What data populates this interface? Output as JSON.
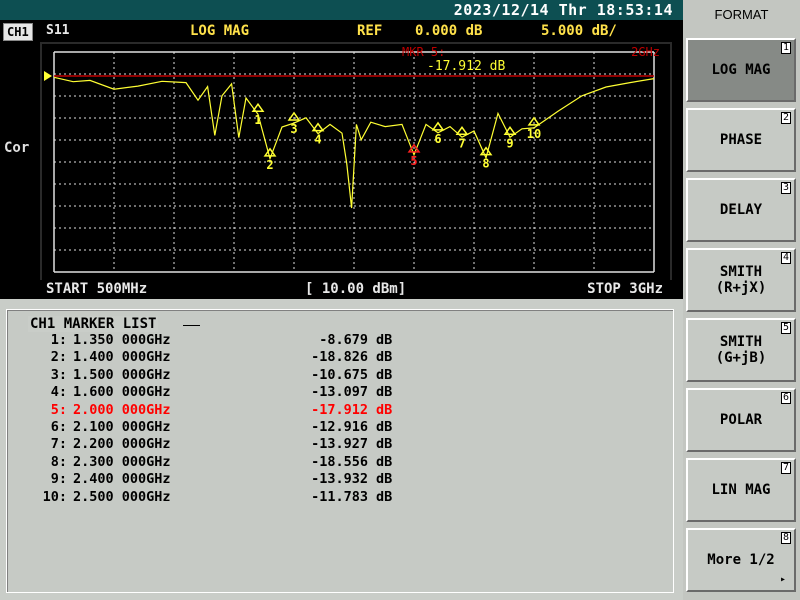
{
  "status": {
    "datetime": "2023/12/14 Thr 18:53:14"
  },
  "header": {
    "channel": "CH1",
    "sparam": "S11",
    "format": "LOG MAG",
    "ref_label": "REF",
    "ref_value": "0.000 dB",
    "scale": "5.000 dB/"
  },
  "side_label": "Cor",
  "plot": {
    "marker_readout_label": "MKR  5:",
    "marker_readout_freq": "2GHz",
    "marker_readout_value": "-17.912 dB",
    "start": "START 500MHz",
    "power": "[ 10.00 dBm]",
    "stop": "STOP 3GHz",
    "colors": {
      "trace": "#ffff33",
      "ref_line": "#c00000",
      "grid": "#e0e0e0",
      "active_marker": "#ff2020"
    }
  },
  "chart_data": {
    "type": "line",
    "x": [
      0.5,
      0.58,
      0.65,
      0.75,
      0.85,
      0.95,
      1.05,
      1.1,
      1.14,
      1.17,
      1.2,
      1.24,
      1.27,
      1.3,
      1.35,
      1.4,
      1.45,
      1.5,
      1.55,
      1.6,
      1.65,
      1.7,
      1.72,
      1.74,
      1.76,
      1.78,
      1.82,
      1.88,
      1.95,
      2.0,
      2.05,
      2.1,
      2.15,
      2.2,
      2.25,
      2.3,
      2.35,
      2.4,
      2.45,
      2.5,
      2.6,
      2.7,
      2.8,
      2.9,
      3.0
    ],
    "y": [
      -0.3,
      -1.3,
      -1.0,
      -3.0,
      -2.3,
      -1.2,
      -1.5,
      -5.5,
      -2.4,
      -13.5,
      -4.5,
      -1.8,
      -14.0,
      -5.0,
      -8.7,
      -18.8,
      -11.6,
      -10.7,
      -9.5,
      -13.1,
      -11.0,
      -13.0,
      -20.0,
      -30.0,
      -11.0,
      -14.5,
      -10.5,
      -11.5,
      -11.0,
      -17.9,
      -11.0,
      -12.9,
      -11.5,
      -13.9,
      -12.5,
      -18.6,
      -8.5,
      -13.9,
      -12.0,
      -11.8,
      -8.0,
      -4.5,
      -2.5,
      -1.5,
      -0.6
    ],
    "xlim": [
      0.5,
      3.0
    ],
    "ylim": [
      -50,
      0
    ],
    "y_per_div": 5,
    "ref": 0,
    "grid": true,
    "marker_labels": [
      "1",
      "2",
      "3",
      "4",
      "5",
      "6",
      "7",
      "8",
      "9",
      "10"
    ],
    "markers": [
      {
        "id": "1",
        "x": 1.35,
        "y": -8.679
      },
      {
        "id": "2",
        "x": 1.4,
        "y": -18.826
      },
      {
        "id": "3",
        "x": 1.5,
        "y": -10.675
      },
      {
        "id": "4",
        "x": 1.6,
        "y": -13.097
      },
      {
        "id": "5",
        "x": 2.0,
        "y": -17.912,
        "active": true
      },
      {
        "id": "6",
        "x": 2.1,
        "y": -12.916
      },
      {
        "id": "7",
        "x": 2.2,
        "y": -13.927
      },
      {
        "id": "8",
        "x": 2.3,
        "y": -18.556
      },
      {
        "id": "9",
        "x": 2.4,
        "y": -13.932
      },
      {
        "id": "10",
        "x": 2.5,
        "y": -11.783
      }
    ]
  },
  "marker_list": {
    "title": "CH1 MARKER LIST",
    "rows": [
      {
        "idx": "1:",
        "freq": "1.350 000GHz",
        "value": "-8.679",
        "unit": "dB"
      },
      {
        "idx": "2:",
        "freq": "1.400 000GHz",
        "value": "-18.826",
        "unit": "dB"
      },
      {
        "idx": "3:",
        "freq": "1.500 000GHz",
        "value": "-10.675",
        "unit": "dB"
      },
      {
        "idx": "4:",
        "freq": "1.600 000GHz",
        "value": "-13.097",
        "unit": "dB"
      },
      {
        "idx": "5:",
        "freq": "2.000 000GHz",
        "value": "-17.912",
        "unit": "dB",
        "active": true
      },
      {
        "idx": "6:",
        "freq": "2.100 000GHz",
        "value": "-12.916",
        "unit": "dB"
      },
      {
        "idx": "7:",
        "freq": "2.200 000GHz",
        "value": "-13.927",
        "unit": "dB"
      },
      {
        "idx": "8:",
        "freq": "2.300 000GHz",
        "value": "-18.556",
        "unit": "dB"
      },
      {
        "idx": "9:",
        "freq": "2.400 000GHz",
        "value": "-13.932",
        "unit": "dB"
      },
      {
        "idx": "10:",
        "freq": "2.500 000GHz",
        "value": "-11.783",
        "unit": "dB"
      }
    ]
  },
  "menu": {
    "title": "FORMAT",
    "keys": [
      {
        "label": "LOG MAG",
        "num": "1",
        "selected": true
      },
      {
        "label": "PHASE",
        "num": "2"
      },
      {
        "label": "DELAY",
        "num": "3"
      },
      {
        "label": "SMITH\n(R+jX)",
        "num": "4"
      },
      {
        "label": "SMITH\n(G+jB)",
        "num": "5"
      },
      {
        "label": "POLAR",
        "num": "6"
      },
      {
        "label": "LIN MAG",
        "num": "7"
      },
      {
        "label": "More 1/2",
        "num": "8",
        "arrow": "▸"
      }
    ]
  }
}
